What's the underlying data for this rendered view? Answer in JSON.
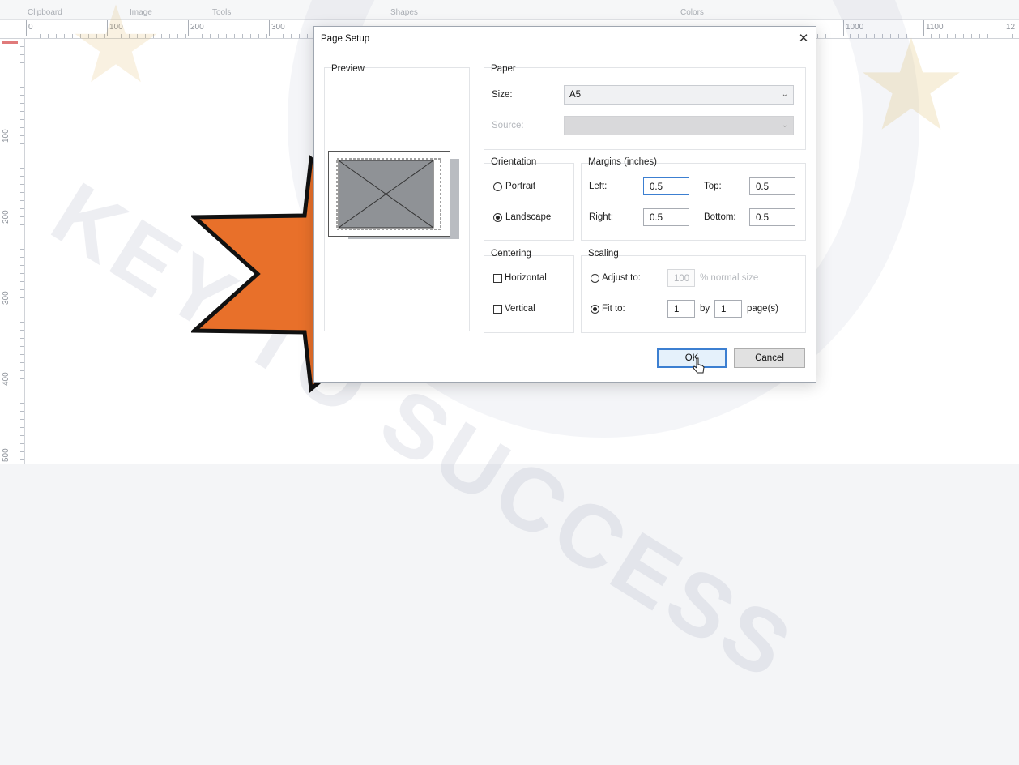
{
  "ribbon": {
    "groups": [
      "Clipboard",
      "Image",
      "Tools",
      "Shapes",
      "Colors"
    ]
  },
  "ruler": {
    "horizontal": [
      "0",
      "100",
      "200",
      "300",
      "1000",
      "1100",
      "12"
    ],
    "vertical": [
      "100",
      "200",
      "300",
      "400",
      "500"
    ]
  },
  "watermark_text": "KEY TO SUCCESS",
  "colors": {
    "star_orange": "#e8702a",
    "star_outline": "#111111",
    "default_button_border": "#3c7fd1",
    "watermark": "#8c96af"
  },
  "dialog": {
    "title": "Page Setup",
    "close_icon": "close-icon",
    "preview": {
      "label": "Preview"
    },
    "paper": {
      "label": "Paper",
      "size_label": "Size:",
      "size_value": "A5",
      "source_label": "Source:",
      "source_value": ""
    },
    "orientation": {
      "label": "Orientation",
      "portrait": "Portrait",
      "landscape": "Landscape",
      "selected": "landscape"
    },
    "margins": {
      "label": "Margins (inches)",
      "left_label": "Left:",
      "left_value": "0.5",
      "right_label": "Right:",
      "right_value": "0.5",
      "top_label": "Top:",
      "top_value": "0.5",
      "bottom_label": "Bottom:",
      "bottom_value": "0.5"
    },
    "centering": {
      "label": "Centering",
      "horizontal": "Horizontal",
      "vertical": "Vertical",
      "horizontal_checked": false,
      "vertical_checked": false
    },
    "scaling": {
      "label": "Scaling",
      "adjust_label": "Adjust to:",
      "adjust_value": "100",
      "adjust_suffix": "% normal size",
      "fit_label": "Fit to:",
      "fit_wide": "1",
      "fit_by": "by",
      "fit_tall": "1",
      "fit_suffix": "page(s)",
      "selected": "fit"
    },
    "buttons": {
      "ok": "OK",
      "cancel": "Cancel"
    }
  }
}
